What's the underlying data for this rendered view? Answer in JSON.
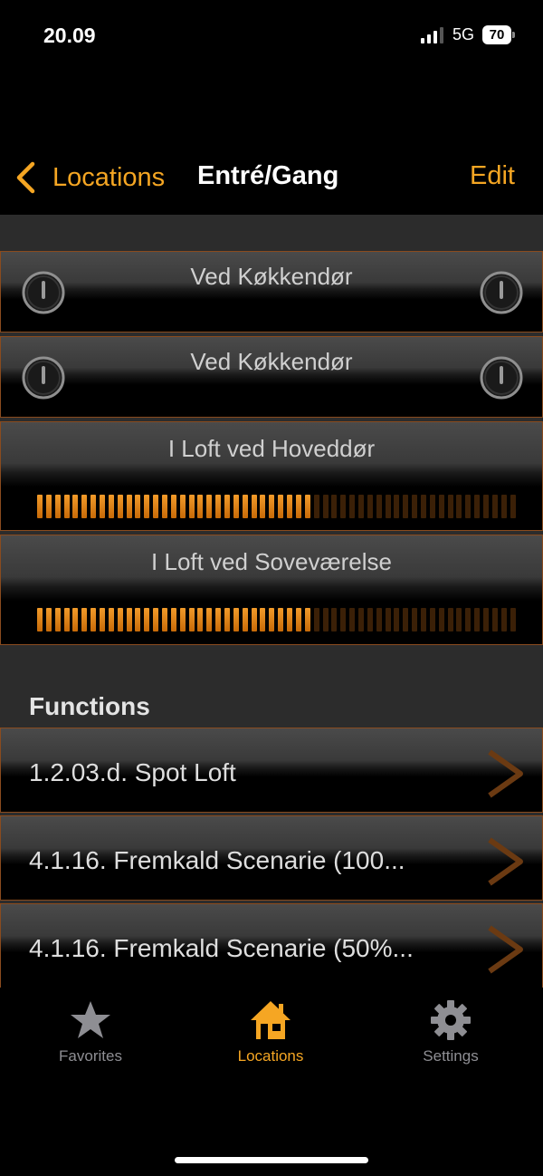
{
  "status": {
    "time": "20.09",
    "network": "5G",
    "battery": "70"
  },
  "nav": {
    "back_label": "Locations",
    "title": "Entré/Gang",
    "edit_label": "Edit"
  },
  "devices": [
    {
      "label": "Ved Køkkendør",
      "type": "switch"
    },
    {
      "label": "Ved Køkkendør",
      "type": "switch"
    },
    {
      "label": "I Loft ved Hoveddør",
      "type": "dimmer",
      "level_percent": 57
    },
    {
      "label": "I Loft ved Soveværelse",
      "type": "dimmer",
      "level_percent": 57
    }
  ],
  "functions": {
    "header": "Functions",
    "items": [
      {
        "label": "1.2.03.d. Spot Loft"
      },
      {
        "label": "4.1.16. Fremkald Scenarie (100..."
      },
      {
        "label": "4.1.16. Fremkald Scenarie (50%..."
      }
    ]
  },
  "tabs": [
    {
      "label": "Favorites",
      "icon": "star-icon",
      "active": false
    },
    {
      "label": "Locations",
      "icon": "house-icon",
      "active": true
    },
    {
      "label": "Settings",
      "icon": "gear-icon",
      "active": false
    }
  ],
  "colors": {
    "accent": "#f5a623",
    "row_border": "#8a4b1e",
    "background": "#2c2c2c"
  }
}
